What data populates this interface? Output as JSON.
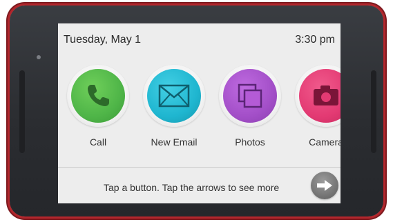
{
  "status_bar": {
    "date": "Tuesday, May 1",
    "time": "3:30 pm"
  },
  "apps": [
    {
      "label": "Call",
      "icon": "phone-icon",
      "color": "#4fb548"
    },
    {
      "label": "New Email",
      "icon": "envelope-icon",
      "color": "#1fb6d0"
    },
    {
      "label": "Photos",
      "icon": "photos-icon",
      "color": "#a34fc8"
    },
    {
      "label": "Camera",
      "icon": "camera-icon",
      "color": "#e33a73"
    }
  ],
  "footer": {
    "hint": "Tap a button. Tap the arrows to see more",
    "next_icon": "arrow-right-icon"
  },
  "device": {
    "frame_color": "#2d2f33",
    "accent_color": "#b3262c"
  }
}
